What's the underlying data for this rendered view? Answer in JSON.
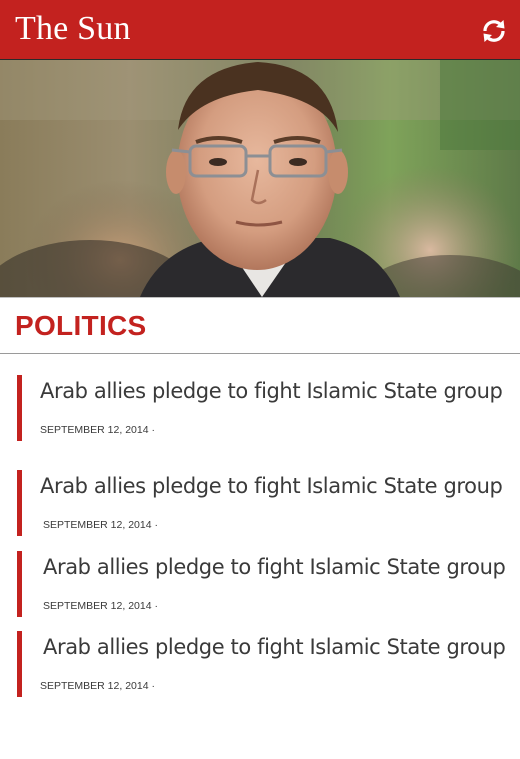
{
  "app": {
    "title": "The Sun",
    "refresh_icon": "refresh-icon",
    "accent_color": "#c3221f"
  },
  "hero": {
    "image": "news-photo-man-with-glasses"
  },
  "section": {
    "title": "POLITICS"
  },
  "articles": [
    {
      "headline": "Arab allies pledge to fight Islamic State group",
      "date": "SEPTEMBER 12, 2014 ·"
    },
    {
      "headline": "Arab allies pledge to fight Islamic State group",
      "date": "SEPTEMBER 12, 2014 ·"
    },
    {
      "headline": "Arab allies pledge to fight Islamic State group",
      "date": "SEPTEMBER 12, 2014 ·"
    },
    {
      "headline": "Arab allies pledge to fight Islamic State group",
      "date": "SEPTEMBER 12, 2014 ·"
    }
  ]
}
